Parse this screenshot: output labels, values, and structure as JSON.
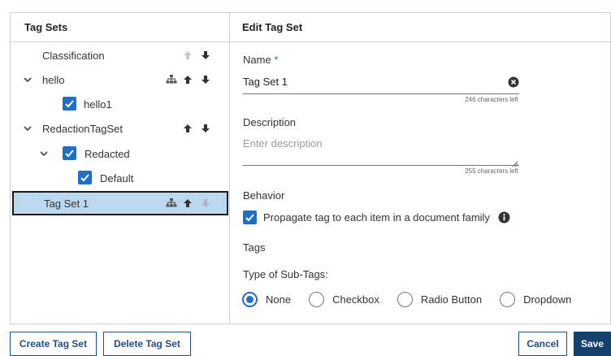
{
  "tag_sets_panel": {
    "title": "Tag Sets",
    "items": [
      {
        "label": "Classification",
        "checked": false,
        "expanded": null,
        "icons": [
          "arrow-up-icon-disabled",
          "arrow-down-icon"
        ]
      },
      {
        "label": "hello",
        "checked": false,
        "expanded": true,
        "icons": [
          "hierarchy-icon",
          "arrow-up-icon",
          "arrow-down-icon"
        ]
      },
      {
        "label": "hello1",
        "checked": true
      },
      {
        "label": "RedactionTagSet",
        "checked": false,
        "expanded": true,
        "icons": [
          "arrow-up-icon",
          "arrow-down-icon"
        ]
      },
      {
        "label": "Redacted",
        "checked": true,
        "expanded": true
      },
      {
        "label": "Default",
        "checked": true
      },
      {
        "label": "Tag Set 1",
        "checked": false,
        "selected": true,
        "icons": [
          "hierarchy-icon",
          "arrow-up-icon",
          "arrow-down-icon-disabled"
        ]
      }
    ]
  },
  "edit_panel": {
    "title": "Edit Tag Set",
    "name_label": "Name",
    "required_marker": "*",
    "name_value": "Tag Set 1",
    "name_counter": "246 characters left",
    "description_label": "Description",
    "description_placeholder": "Enter description",
    "description_counter": "255 characters left",
    "behavior_label": "Behavior",
    "propagate_label": "Propagate tag to each item in a document family",
    "propagate_checked": true,
    "tags_label": "Tags",
    "subtags_label": "Type of Sub-Tags:",
    "subtag_options": [
      "None",
      "Checkbox",
      "Radio Button",
      "Dropdown"
    ],
    "subtag_selected": "None"
  },
  "footer": {
    "create_label": "Create Tag Set",
    "delete_label": "Delete Tag Set",
    "cancel_label": "Cancel",
    "save_label": "Save"
  },
  "colors": {
    "accent": "#1f6fc8",
    "selected_row": "#bcd8ef",
    "primary_button": "#14406e"
  }
}
